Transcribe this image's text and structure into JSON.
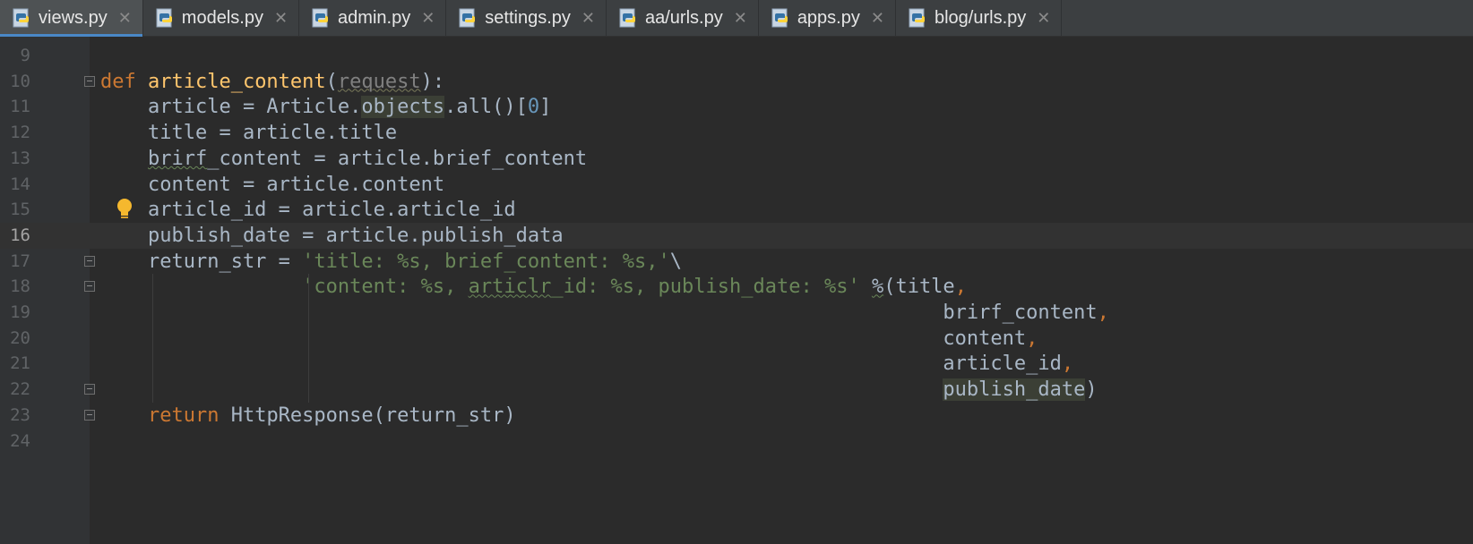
{
  "tabs": [
    {
      "label": "views.py",
      "active": true,
      "icon": "python-file-icon"
    },
    {
      "label": "models.py",
      "active": false,
      "icon": "python-file-icon"
    },
    {
      "label": "admin.py",
      "active": false,
      "icon": "python-file-icon"
    },
    {
      "label": "settings.py",
      "active": false,
      "icon": "python-file-icon"
    },
    {
      "label": "aa/urls.py",
      "active": false,
      "icon": "python-file-icon"
    },
    {
      "label": "apps.py",
      "active": false,
      "icon": "python-file-icon"
    },
    {
      "label": "blog/urls.py",
      "active": false,
      "icon": "python-file-icon"
    }
  ],
  "close_glyph": "✕",
  "lines": [
    {
      "n": "9",
      "tokens": []
    },
    {
      "n": "10",
      "tokens": [
        [
          "kw",
          "def "
        ],
        [
          "fn",
          "article_content"
        ],
        [
          "",
          "("
        ],
        [
          "param squig2",
          "request"
        ],
        [
          "",
          "):"
        ]
      ]
    },
    {
      "n": "11",
      "tokens": [
        [
          "",
          "    article = Article."
        ],
        [
          "hl",
          "objects"
        ],
        [
          "",
          ".all()["
        ],
        [
          "num",
          "0"
        ],
        [
          "",
          "]"
        ]
      ]
    },
    {
      "n": "12",
      "tokens": [
        [
          "",
          "    title = article.title"
        ]
      ]
    },
    {
      "n": "13",
      "tokens": [
        [
          "",
          "    "
        ],
        [
          "squig",
          "brirf"
        ],
        [
          "",
          "_content = article.brief_content"
        ]
      ]
    },
    {
      "n": "14",
      "tokens": [
        [
          "",
          "    content = article.content"
        ]
      ]
    },
    {
      "n": "15",
      "tokens": [
        [
          "",
          "    article_id = article.article_id"
        ]
      ]
    },
    {
      "n": "16",
      "tokens": [
        [
          "",
          "    publish_date = article.publish_data"
        ]
      ],
      "current": true
    },
    {
      "n": "17",
      "tokens": [
        [
          "",
          "    return_str = "
        ],
        [
          "str",
          "'title: %s, brief_content: %s,'"
        ],
        [
          "",
          "\\"
        ]
      ]
    },
    {
      "n": "18",
      "tokens": [
        [
          "",
          "                 "
        ],
        [
          "str",
          "'content: %s, "
        ],
        [
          "str squig",
          "articlr"
        ],
        [
          "str",
          "_id: %s, publish_date: %s'"
        ],
        [
          "",
          " "
        ],
        [
          "squig",
          "%"
        ],
        [
          "",
          "(title"
        ],
        [
          "punc",
          ","
        ]
      ]
    },
    {
      "n": "19",
      "tokens": [
        [
          "",
          "                                                                       brirf_content"
        ],
        [
          "punc",
          ","
        ]
      ]
    },
    {
      "n": "20",
      "tokens": [
        [
          "",
          "                                                                       content"
        ],
        [
          "punc",
          ","
        ]
      ]
    },
    {
      "n": "21",
      "tokens": [
        [
          "",
          "                                                                       article_id"
        ],
        [
          "punc",
          ","
        ]
      ]
    },
    {
      "n": "22",
      "tokens": [
        [
          "",
          "                                                                       "
        ],
        [
          "hl",
          "publish_date"
        ],
        [
          "",
          ")"
        ]
      ]
    },
    {
      "n": "23",
      "tokens": [
        [
          "",
          "    "
        ],
        [
          "kw",
          "return "
        ],
        [
          "",
          "HttpResponse(return_str)"
        ]
      ]
    },
    {
      "n": "24",
      "tokens": []
    }
  ],
  "colors": {
    "background": "#2b2b2b",
    "keyword": "#cc7832",
    "function": "#ffc66d",
    "string": "#6a8759",
    "number": "#6897bb",
    "identifier": "#a9b7c6"
  }
}
